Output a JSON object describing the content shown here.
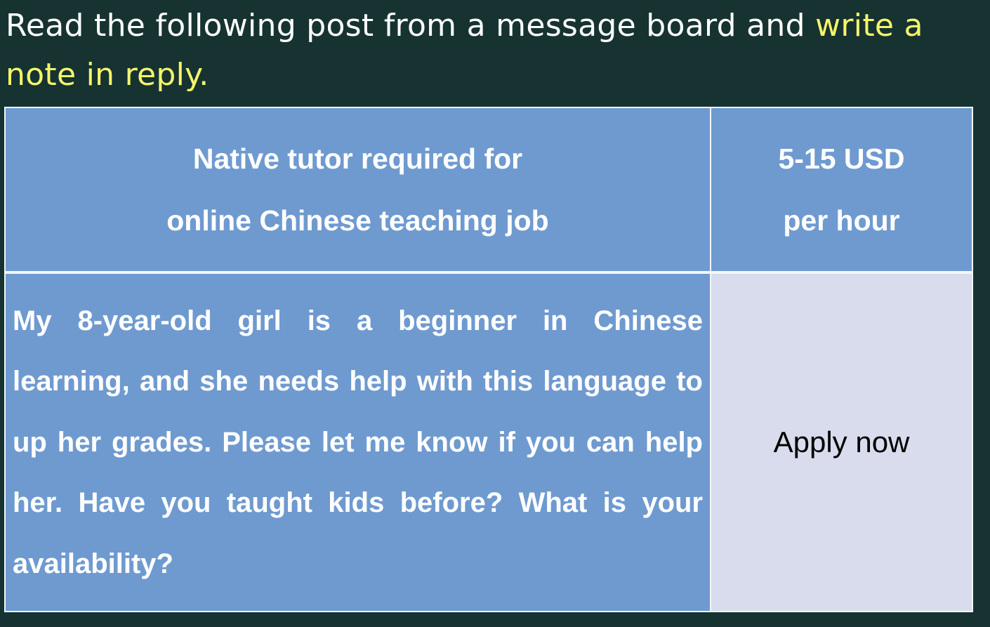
{
  "instruction": {
    "plain": "Read the following post from a message board and ",
    "highlight": "write a note in reply."
  },
  "post": {
    "title_line1": "Native tutor required for",
    "title_line2": "online Chinese teaching job",
    "pay_line1": "5-15 USD",
    "pay_line2": "per hour",
    "message": "My 8-year-old girl is a beginner in Chinese learning, and she needs help with this language to up her grades. Please let me know if you can help her. Have you taught kids before? What is your availability?",
    "apply_label": "Apply now"
  },
  "colors": {
    "background": "#163332",
    "highlight": "#f7f56a",
    "table_blue": "#6f9ad0",
    "apply_cell": "#d8dcec"
  }
}
